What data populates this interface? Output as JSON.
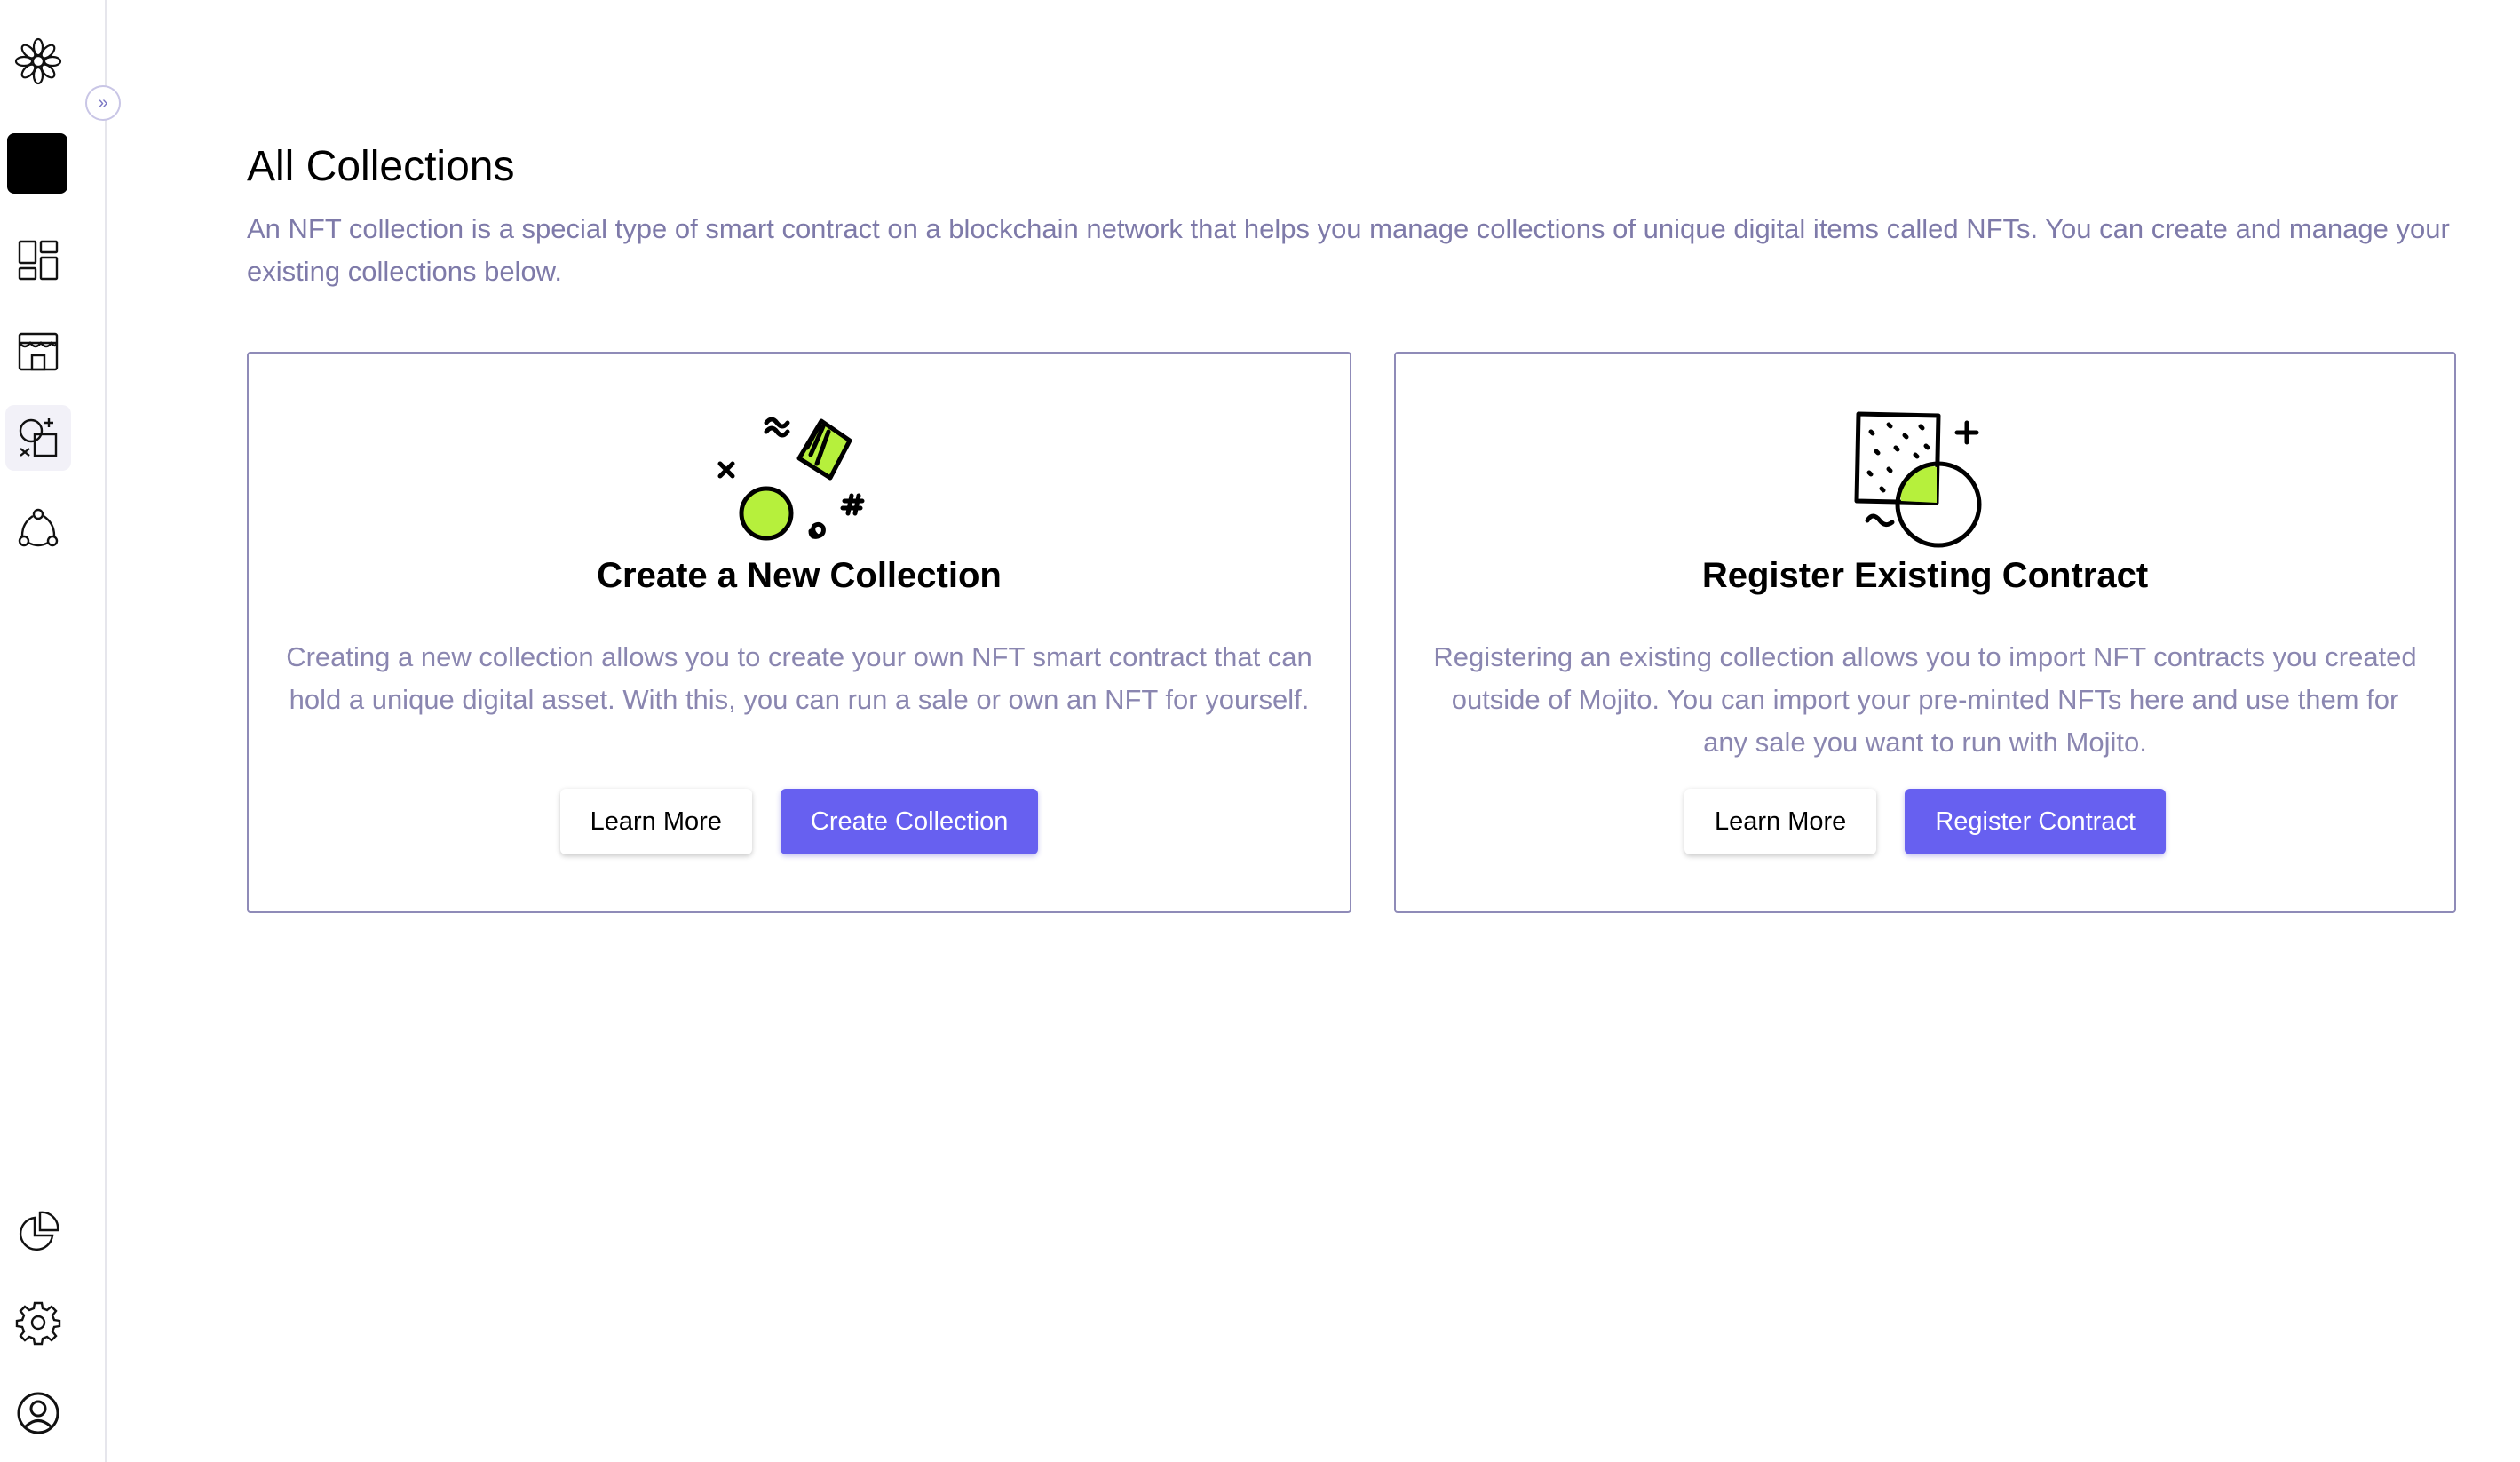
{
  "sidebar": {
    "expand_glyph": "»",
    "items_top": [
      {
        "icon": "flower-logo-icon"
      },
      {
        "icon": "brand-square-icon"
      },
      {
        "icon": "dashboard-icon"
      },
      {
        "icon": "storefront-icon"
      },
      {
        "icon": "collections-icon",
        "active": true
      },
      {
        "icon": "network-icon"
      }
    ],
    "items_bottom": [
      {
        "icon": "pie-chart-icon"
      },
      {
        "icon": "gear-icon"
      },
      {
        "icon": "user-circle-icon"
      }
    ]
  },
  "page": {
    "title": "All Collections",
    "description": "An NFT collection is a special type of smart contract on a blockchain network that helps you manage collections of unique digital items called NFTs. You can create and manage your existing collections below."
  },
  "cards": {
    "create": {
      "title": "Create a New Collection",
      "text": "Creating a new collection allows you to create your own NFT smart contract that can hold a unique digital asset. With this, you can run a sale or own an NFT for yourself.",
      "learn_more": "Learn More",
      "primary": "Create Collection"
    },
    "register": {
      "title": "Register Existing Contract",
      "text": "Registering an existing collection allows you to import NFT contracts you created outside of Mojito. You can import your pre-minted NFTs here and use them for any sale you want to run with Mojito.",
      "learn_more": "Learn More",
      "primary": "Register Contract"
    }
  },
  "colors": {
    "accent": "#6760f0",
    "muted_text": "#7e7aa9",
    "card_border": "#8f8bb8",
    "illustration_green": "#b6f03c"
  }
}
